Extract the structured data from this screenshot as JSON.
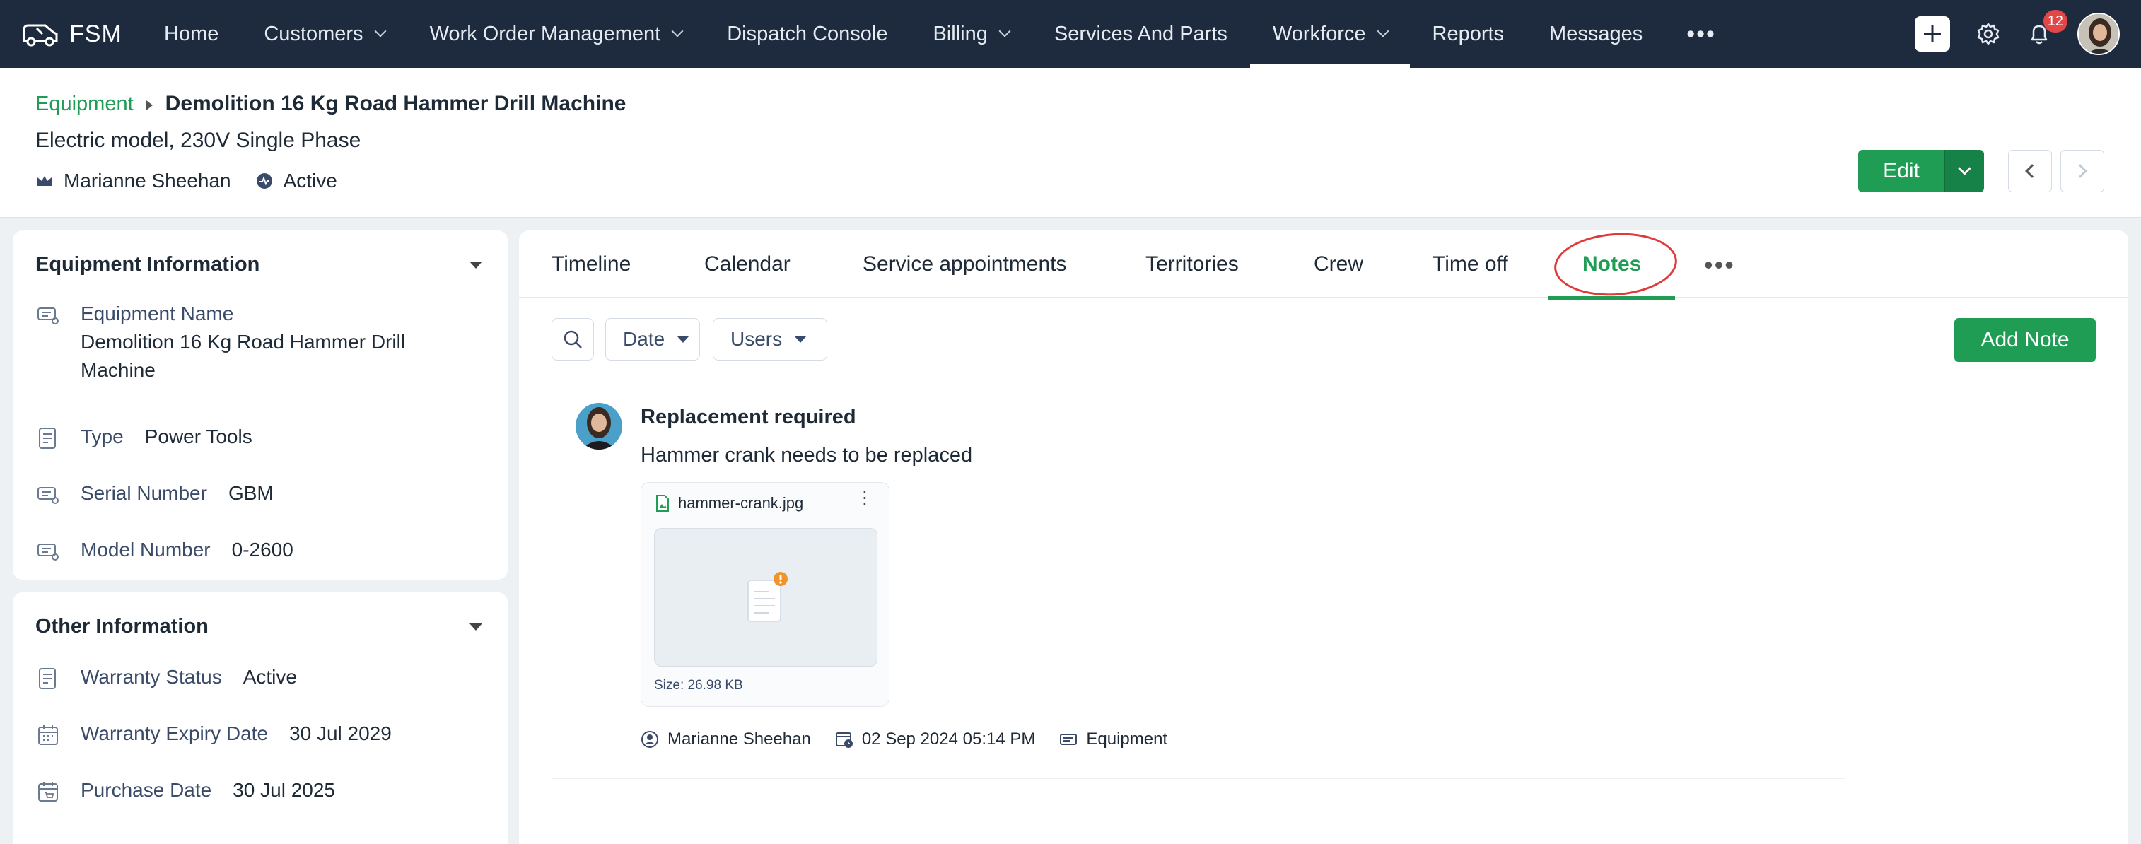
{
  "app": {
    "brand": "FSM"
  },
  "nav": {
    "items": [
      {
        "label": "Home",
        "has_dropdown": false,
        "active": false
      },
      {
        "label": "Customers",
        "has_dropdown": true,
        "active": false
      },
      {
        "label": "Work Order Management",
        "has_dropdown": true,
        "active": false
      },
      {
        "label": "Dispatch Console",
        "has_dropdown": false,
        "active": false
      },
      {
        "label": "Billing",
        "has_dropdown": true,
        "active": false
      },
      {
        "label": "Services And Parts",
        "has_dropdown": false,
        "active": false
      },
      {
        "label": "Workforce",
        "has_dropdown": true,
        "active": true
      },
      {
        "label": "Reports",
        "has_dropdown": false,
        "active": false
      },
      {
        "label": "Messages",
        "has_dropdown": false,
        "active": false
      }
    ],
    "more": "•••",
    "notification_count": "12"
  },
  "record": {
    "breadcrumb_module": "Equipment",
    "title": "Demolition 16 Kg Road Hammer Drill Machine",
    "subtitle": "Electric model, 230V Single Phase",
    "owner": "Marianne Sheehan",
    "status": "Active",
    "edit_label": "Edit"
  },
  "equipment_info": {
    "heading": "Equipment Information",
    "fields": [
      {
        "label": "Equipment Name",
        "value": "Demolition 16 Kg Road Hammer Drill Machine"
      },
      {
        "label": "Type",
        "value": "Power Tools"
      },
      {
        "label": "Serial Number",
        "value": "GBM"
      },
      {
        "label": "Model Number",
        "value": "0-2600"
      }
    ]
  },
  "other_info": {
    "heading": "Other Information",
    "fields": [
      {
        "label": "Warranty Status",
        "value": "Active"
      },
      {
        "label": "Warranty Expiry Date",
        "value": "30 Jul 2029"
      },
      {
        "label": "Purchase Date",
        "value": "30 Jul 2025"
      }
    ]
  },
  "tabs": [
    {
      "label": "Timeline",
      "active": false
    },
    {
      "label": "Calendar",
      "active": false
    },
    {
      "label": "Service appointments",
      "active": false
    },
    {
      "label": "Territories",
      "active": false
    },
    {
      "label": "Crew",
      "active": false
    },
    {
      "label": "Time off",
      "active": false
    },
    {
      "label": "Notes",
      "active": true
    }
  ],
  "tabs_more": "•••",
  "toolbar": {
    "date_filter": "Date",
    "users_filter": "Users",
    "add_note": "Add Note"
  },
  "note": {
    "title": "Replacement required",
    "body": "Hammer crank needs to be replaced",
    "attachment": {
      "name": "hammer-crank.jpg",
      "size": "Size: 26.98 KB"
    },
    "author": "Marianne Sheehan",
    "timestamp": "02 Sep 2024 05:14 PM",
    "module": "Equipment"
  },
  "colors": {
    "nav_bg": "#1e2b3f",
    "accent_green": "#1f9d55",
    "highlight_ring": "#e03a3a",
    "badge_red": "#e24646"
  }
}
